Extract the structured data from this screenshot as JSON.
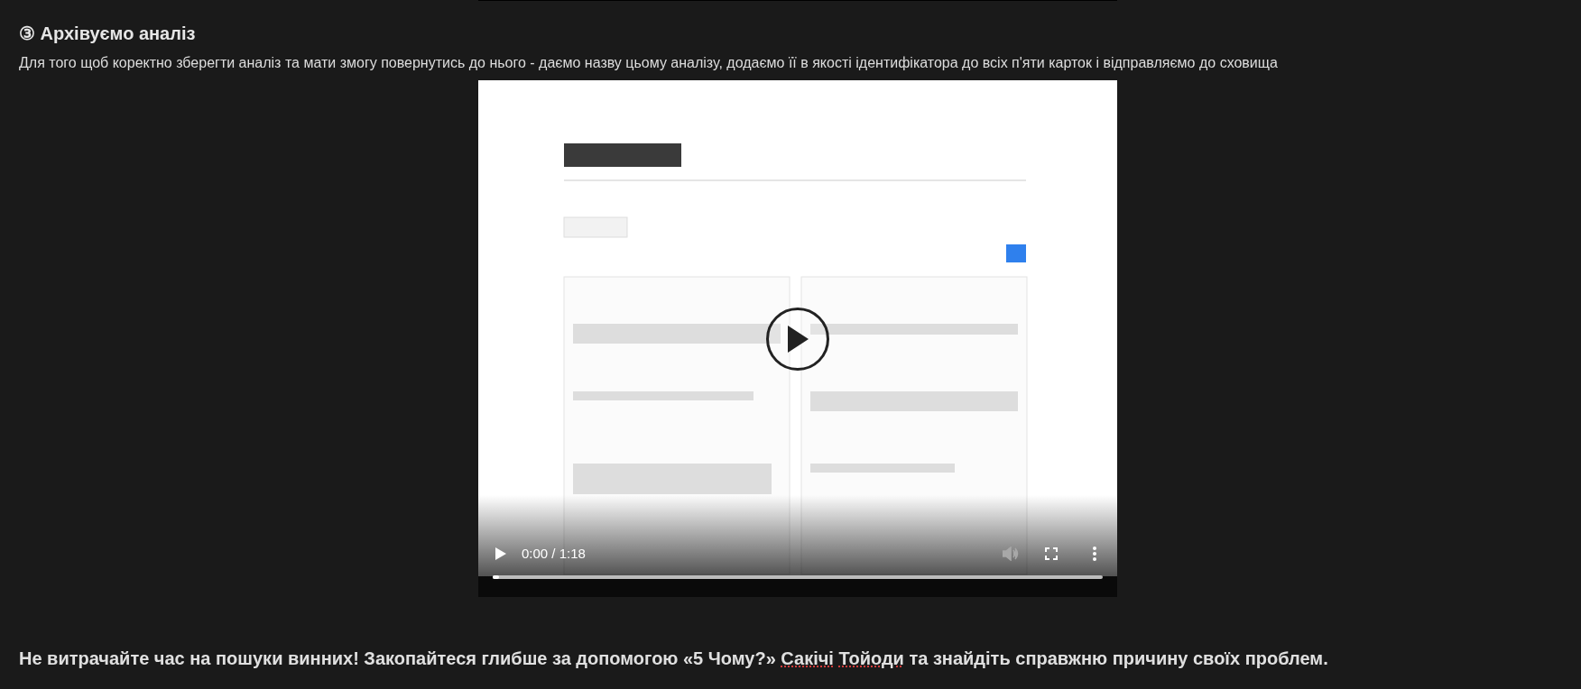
{
  "section": {
    "heading": "③ Архівуємо аналіз",
    "description": "Для того щоб коректно зберегти аналіз та мати змогу повернутись до нього - даємо назву цьому аналізу, додаємо її в якості ідентифікатора до всіх п'яти карток і відправляємо до сховища"
  },
  "video": {
    "kind": "picture",
    "playing": false,
    "time": "0:00 / 1:18",
    "volume_disabled": true,
    "progress": {
      "level": 0.01
    }
  },
  "closing": {
    "before": "Не витрачайте час на пошуки винних! Закопайтеся глибше за допомогою «5 Чому?» ",
    "flagged_words": [
      "Сакічі",
      "Тойоди"
    ],
    "after": " та знайдіть справжню причину своїх проблем."
  }
}
